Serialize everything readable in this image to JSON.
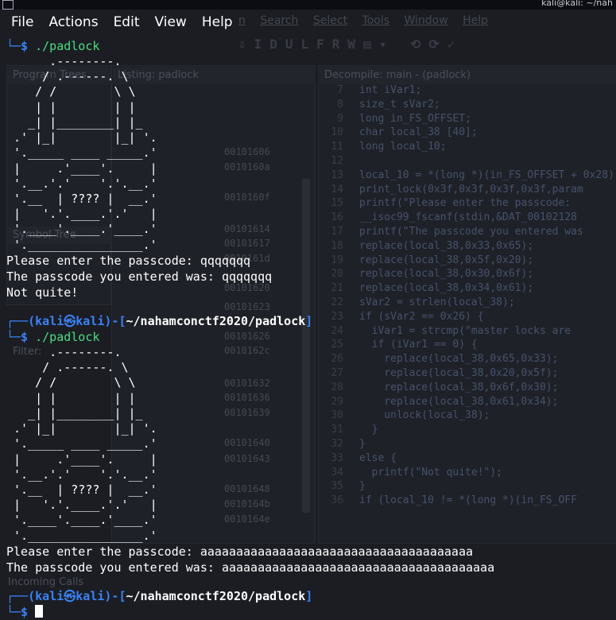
{
  "system_bar": {
    "userhost": "kali@kali: ~/nah"
  },
  "ghidra": {
    "menu": [
      "n",
      "Search",
      "Select",
      "Tools",
      "Window",
      "Help"
    ],
    "panels": {
      "program_trees": "Program Trees",
      "listing": "Listing: padlock",
      "decompile": "Decompile: main - (padlock)",
      "symbol_tree": "Symbol Tree",
      "filter": "Filter:",
      "incoming_calls": "Incoming Calls"
    },
    "addresses": [
      "00101606",
      "0010160a",
      "0010160f",
      "00101614",
      "00101617",
      "0010161d",
      "00101620",
      "00101623",
      "00101626",
      "0010162c",
      "00101632",
      "00101636",
      "00101639",
      "00101640",
      "00101643",
      "00101648",
      "0010164b",
      "0010164e"
    ],
    "code_lines": [
      {
        "n": "7",
        "t": "int iVar1;"
      },
      {
        "n": "8",
        "t": "size_t sVar2;"
      },
      {
        "n": "9",
        "t": "long in_FS_OFFSET;"
      },
      {
        "n": "10",
        "t": "char local_38 [40];"
      },
      {
        "n": "11",
        "t": "long local_10;"
      },
      {
        "n": "12",
        "t": ""
      },
      {
        "n": "13",
        "t": "local_10 = *(long *)(in_FS_OFFSET + 0x28);"
      },
      {
        "n": "14",
        "t": "print_lock(0x3f,0x3f,0x3f,0x3f,param"
      },
      {
        "n": "15",
        "t": "printf(\"Please enter the passcode: "
      },
      {
        "n": "16",
        "t": "__isoc99_fscanf(stdin,&DAT_00102128"
      },
      {
        "n": "17",
        "t": "printf(\"The passcode you entered was"
      },
      {
        "n": "18",
        "t": "replace(local_38,0x33,0x65);"
      },
      {
        "n": "19",
        "t": "replace(local_38,0x5f,0x20);"
      },
      {
        "n": "20",
        "t": "replace(local_38,0x30,0x6f);"
      },
      {
        "n": "21",
        "t": "replace(local_38,0x34,0x61);"
      },
      {
        "n": "22",
        "t": "sVar2 = strlen(local_38);"
      },
      {
        "n": "23",
        "t": "if (sVar2 == 0x26) {"
      },
      {
        "n": "24",
        "t": "  iVar1 = strcmp(\"master locks are"
      },
      {
        "n": "25",
        "t": "  if (iVar1 == 0) {"
      },
      {
        "n": "26",
        "t": "    replace(local_38,0x65,0x33);"
      },
      {
        "n": "27",
        "t": "    replace(local_38,0x20,0x5f);"
      },
      {
        "n": "28",
        "t": "    replace(local_38,0x6f,0x30);"
      },
      {
        "n": "29",
        "t": "    replace(local_38,0x61,0x34);"
      },
      {
        "n": "30",
        "t": "    unlock(local_38);"
      },
      {
        "n": "31",
        "t": "  }"
      },
      {
        "n": "32",
        "t": "}"
      },
      {
        "n": "33",
        "t": "else {"
      },
      {
        "n": "34",
        "t": "  printf(\"Not quite!\");"
      },
      {
        "n": "35",
        "t": "}"
      },
      {
        "n": "36",
        "t": "if (local_10 != *(long *)(in_FS_OFF"
      }
    ]
  },
  "terminal": {
    "menu": [
      "File",
      "Actions",
      "Edit",
      "View",
      "Help"
    ],
    "prompt_prefix": "└─$ ",
    "command": "./padlock",
    "user": "kali",
    "skull": "㉿",
    "host": "kali",
    "path": "~/nahamconctf2020/padlock",
    "prompt_open": "┌──(",
    "prompt_mid": ")-[",
    "prompt_close": "]",
    "padlock_art": [
      "      .--------.",
      "     / .------. \\",
      "    / /        \\ \\",
      "    | |        | |",
      "   _| |________| |_",
      " .' |_|        |_| '.",
      " '._____ ____ _____.'",
      " |     .'____'.     |",
      " '.__.'.'    '.'.__.'",
      " '.__  | ???? |  __.'",
      " |   '.'.____.'.'   |",
      " '.____'.____.'____.'",
      " '.________________.'"
    ],
    "run1": {
      "prompt": "Please enter the passcode: ",
      "input": "qqqqqqq",
      "echo_label": "The passcode you entered was: ",
      "echo_value": "qqqqqqq",
      "result": "Not quite!"
    },
    "run2": {
      "prompt": "Please enter the passcode: ",
      "input": "aaaaaaaaaaaaaaaaaaaaaaaaaaaaaaaaaaaaaa",
      "echo_label": "The passcode you entered was: ",
      "echo_value": "aaaaaaaaaaaaaaaaaaaaaaaaaaaaaaaaaaaaaa"
    }
  }
}
